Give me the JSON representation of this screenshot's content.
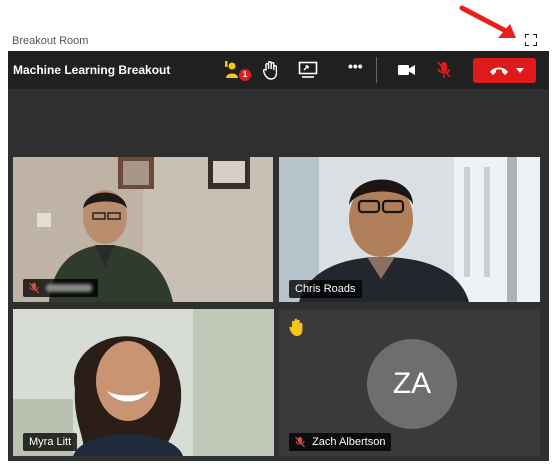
{
  "window": {
    "title": "Breakout Room"
  },
  "toolbar": {
    "meeting_title": "Machine Learning Breakout",
    "participants_badge": "1",
    "more_label": "•••"
  },
  "colors": {
    "leave_red": "#e01a1a",
    "raised_hand": "#f5c518",
    "avatar_bg": "#6e6e6e"
  },
  "participants": [
    {
      "name": "",
      "muted": true,
      "name_obscured": true
    },
    {
      "name": "Chris Roads",
      "muted": false
    },
    {
      "name": "Myra Litt",
      "muted": false
    },
    {
      "name": "Zach Albertson",
      "initials": "ZA",
      "muted": true,
      "hand_raised": true
    }
  ]
}
